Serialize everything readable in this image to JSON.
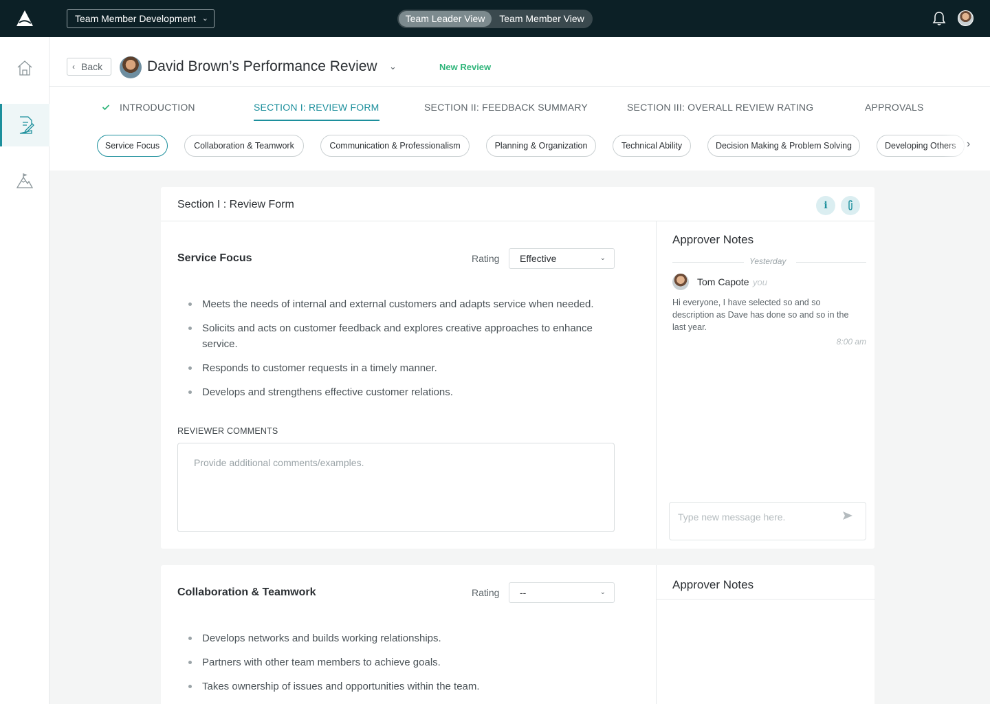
{
  "topbar": {
    "workspace": "Team Member Development",
    "view_toggle": {
      "active": "Team Leader View",
      "inactive": "Team Member View"
    }
  },
  "sidebar": {
    "items": [
      {
        "icon": "home-icon"
      },
      {
        "icon": "review-form-icon",
        "active": true
      },
      {
        "icon": "mountain-icon"
      }
    ]
  },
  "header": {
    "back_label": "Back",
    "title": "David Brown’s Performance Review",
    "status": "New Review",
    "status_color": "#2fb57a",
    "tabs": [
      {
        "label": "INTRODUCTION",
        "completed": true
      },
      {
        "label": "SECTION I: REVIEW FORM",
        "active": true
      },
      {
        "label": "SECTION II: FEEDBACK SUMMARY"
      },
      {
        "label": "SECTION III: OVERALL REVIEW RATING"
      },
      {
        "label": "APPROVALS"
      }
    ],
    "chips": [
      "Service Focus",
      "Collaboration & Teamwork",
      "Communication & Professionalism",
      "Planning & Organization",
      "Technical Ability",
      "Decision Making & Problem Solving",
      "Developing Others"
    ]
  },
  "accent_color": "#1c8f9c",
  "form": {
    "title": "Section I : Review Form",
    "rating_label": "Rating",
    "comments_label": "REVIEWER COMMENTS",
    "comments_placeholder": "Provide additional comments/examples.",
    "notes_title": "Approver Notes",
    "competencies": [
      {
        "name": "Service Focus",
        "rating": "Effective",
        "bullets": [
          "Meets the needs of internal and external customers and adapts service when needed.",
          "Solicits and acts on customer feedback and explores creative approaches to enhance service.",
          "Responds to customer requests in a timely manner.",
          "Develops and strengthens effective customer relations."
        ],
        "notes": {
          "day": "Yesterday",
          "author": "Tom Capote",
          "you": "you",
          "text": "Hi everyone, I have selected so and so description as Dave has done so and so in the last year.",
          "time": "8:00 am",
          "message_placeholder": "Type new message here."
        }
      },
      {
        "name": "Collaboration & Teamwork",
        "rating": "--",
        "bullets": [
          "Develops networks and builds working relationships.",
          "Partners with other team members to achieve goals.",
          "Takes ownership of issues and opportunities within the team."
        ]
      }
    ]
  }
}
